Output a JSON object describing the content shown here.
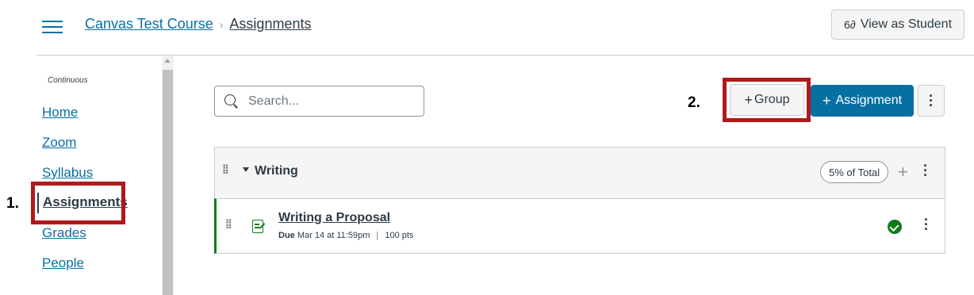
{
  "header": {
    "breadcrumb": {
      "course": "Canvas Test Course",
      "separator": "›",
      "current": "Assignments"
    },
    "view_as_student": {
      "icon": "glasses-icon",
      "label": "View as Student"
    }
  },
  "sidebar": {
    "term": "Continuous",
    "items": [
      {
        "label": "Home",
        "active": false
      },
      {
        "label": "Zoom",
        "active": false
      },
      {
        "label": "Syllabus",
        "active": false
      },
      {
        "label": "Assignments",
        "active": true
      },
      {
        "label": "Grades",
        "active": false
      },
      {
        "label": "People",
        "active": false
      }
    ]
  },
  "toolbar": {
    "search_placeholder": "Search...",
    "group_button_label": "Group",
    "assignment_button_label": "Assignment"
  },
  "assignment_groups": [
    {
      "name": "Writing",
      "weight": "5% of Total",
      "assignments": [
        {
          "title": "Writing a Proposal",
          "due_label": "Due",
          "due_date": "Mar 14 at 11:59pm",
          "separator": "|",
          "points": "100 pts",
          "status": "published"
        }
      ]
    }
  ],
  "annotations": {
    "step1": "1.",
    "step2": "2."
  },
  "colors": {
    "link": "#0770a3",
    "primary_button": "#0770a3",
    "published": "#127a1b",
    "annotation": "#b0191b"
  }
}
